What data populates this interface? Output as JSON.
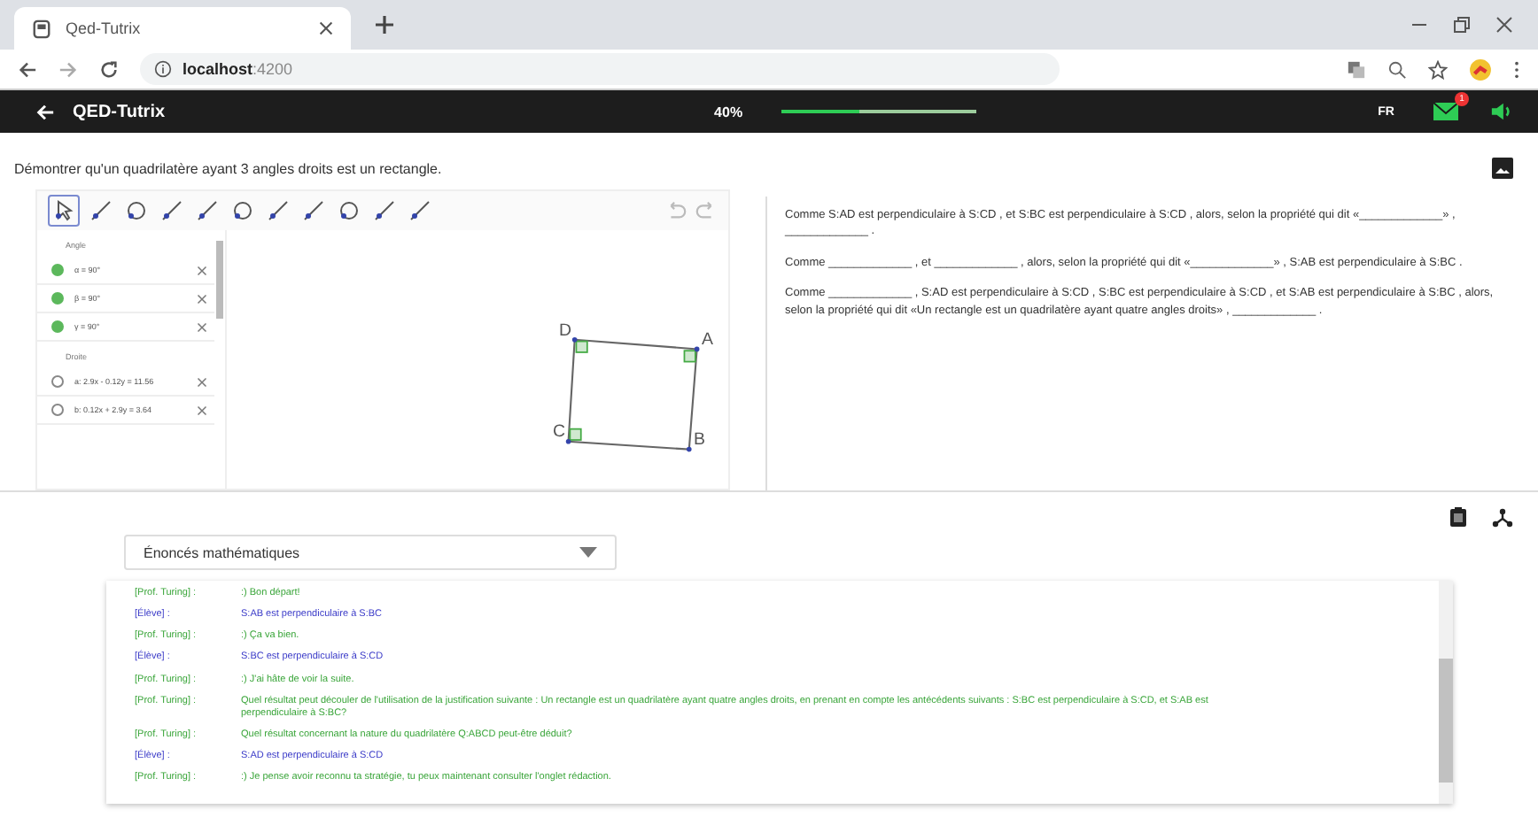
{
  "browser": {
    "tab_title": "Qed-Tutrix",
    "url_host": "localhost",
    "url_port": ":4200"
  },
  "app_bar": {
    "title": "QED-Tutrix",
    "progress_label": "40%",
    "progress": {
      "level": 0.4
    },
    "language": "FR",
    "mail_badge": "1"
  },
  "problem": "Démontrer qu'un quadrilatère ayant 3 angles droits est un rectangle.",
  "geometry": {
    "groups": [
      {
        "title": "Angle",
        "items": [
          {
            "label": "α = 90°",
            "visible": true
          },
          {
            "label": "β = 90°",
            "visible": true
          },
          {
            "label": "γ = 90°",
            "visible": true
          }
        ]
      },
      {
        "title": "Droite",
        "items": [
          {
            "label": "a: 2.9x - 0.12y = 11.56",
            "visible": false
          },
          {
            "label": "b: 0.12x + 2.9y = 3.64",
            "visible": false
          }
        ]
      }
    ],
    "points": [
      {
        "label": "D"
      },
      {
        "label": "A"
      },
      {
        "label": "C"
      },
      {
        "label": "B"
      }
    ]
  },
  "statements": [
    "Comme S:AD est perpendiculaire à S:CD , et S:BC est perpendiculaire à S:CD , alors, selon la propriété qui dit «_____________» , _____________ .",
    "Comme _____________ , et _____________ , alors, selon la propriété qui dit «_____________» , S:AB est perpendiculaire à S:BC .",
    "Comme _____________ , S:AD est perpendiculaire à S:CD , S:BC est perpendiculaire à S:CD , et S:AB est perpendiculaire à S:BC , alors, selon la propriété qui dit «Un rectangle est un quadrilatère ayant quatre angles droits» , _____________ ."
  ],
  "dropdown": "Énoncés mathématiques",
  "chat": [
    {
      "kind": "tutor",
      "speaker": "[Prof. Turing] :",
      "text": ":) Bon départ!"
    },
    {
      "kind": "student",
      "speaker": "[Élève] :",
      "text": "S:AB est perpendiculaire à S:BC"
    },
    {
      "kind": "tutor",
      "speaker": "[Prof. Turing] :",
      "text": ":) Ça va bien."
    },
    {
      "kind": "student",
      "speaker": "[Élève] :",
      "text": "S:BC est perpendiculaire à S:CD"
    },
    {
      "kind": "tutor",
      "speaker": "[Prof. Turing] :",
      "text": ":) J'ai hâte de voir la suite."
    },
    {
      "kind": "tutor",
      "speaker": "[Prof. Turing] :",
      "text": "Quel résultat peut découler de l'utilisation de la justification suivante : Un rectangle est un quadrilatère ayant quatre angles droits, en prenant en compte les antécédents suivants : S:BC est perpendiculaire à S:CD, et S:AB est perpendiculaire à S:BC?"
    },
    {
      "kind": "tutor",
      "speaker": "[Prof. Turing] :",
      "text": "Quel résultat concernant la nature du quadrilatère Q:ABCD peut-être déduit?"
    },
    {
      "kind": "student",
      "speaker": "[Élève] :",
      "text": "S:AD est perpendiculaire à S:CD"
    },
    {
      "kind": "tutor",
      "speaker": "[Prof. Turing] :",
      "text": ":) Je pense avoir reconnu ta stratégie, tu peux maintenant consulter l'onglet rédaction."
    }
  ]
}
